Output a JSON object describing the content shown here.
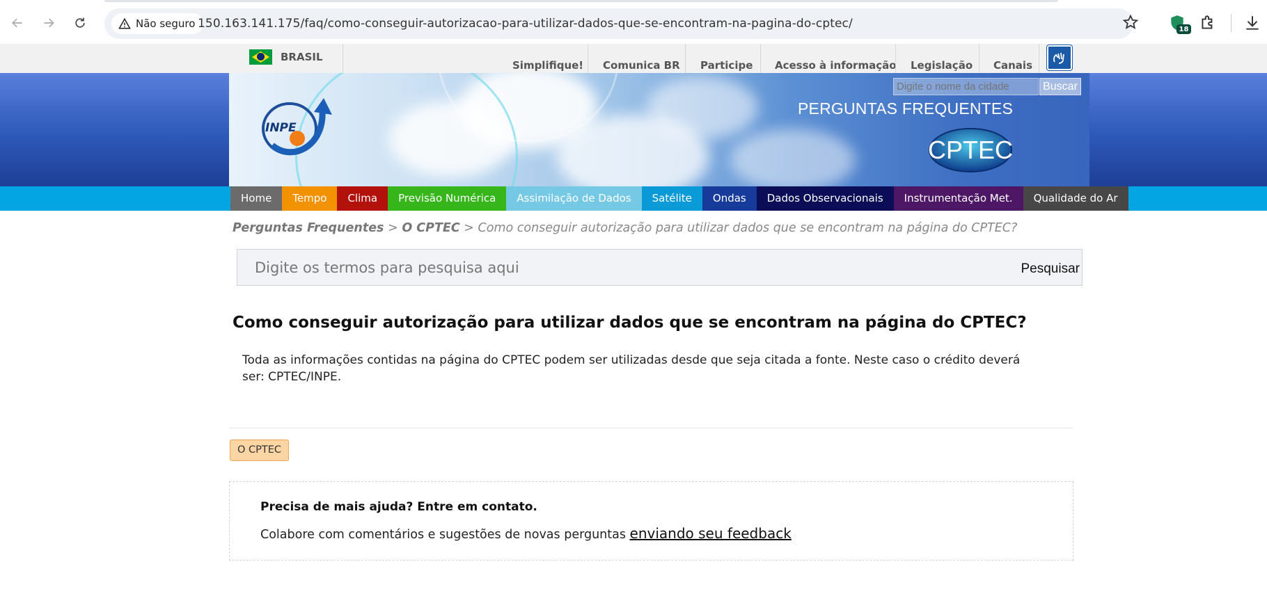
{
  "browser": {
    "security_label": "Não seguro",
    "url": "150.163.141.175/faq/como-conseguir-autorizacao-para-utilizar-dados-que-se-encontram-na-pagina-do-cptec/",
    "extension_badge": "18"
  },
  "govbar": {
    "country": "BRASIL",
    "links": [
      "Simplifique!",
      "Comunica BR",
      "Participe",
      "Acesso à informação",
      "Legislação",
      "Canais"
    ]
  },
  "header": {
    "logo_text": "INPE",
    "title": "PERGUNTAS FREQUENTES",
    "brand": "CPTEC",
    "city_search_placeholder": "Digite o nome da cidade",
    "city_search_button": "Buscar"
  },
  "menu": [
    {
      "label": "Home",
      "color": "#6b6b6b"
    },
    {
      "label": "Tempo",
      "color": "#f39200"
    },
    {
      "label": "Clima",
      "color": "#b3110c"
    },
    {
      "label": "Previsão Numérica",
      "color": "#36b61a"
    },
    {
      "label": "Assimilação de Dados",
      "color": "#75c9e4"
    },
    {
      "label": "Satélite",
      "color": "#0a9ad7"
    },
    {
      "label": "Ondas",
      "color": "#173b9a"
    },
    {
      "label": "Dados Observacionais",
      "color": "#0b0d57"
    },
    {
      "label": "Instrumentação Met.",
      "color": "#4e1766"
    },
    {
      "label": "Qualidade do Ar",
      "color": "#474747"
    }
  ],
  "breadcrumb": {
    "root": "Perguntas Frequentes",
    "sep": ">",
    "category": "O CPTEC",
    "current": "Como conseguir autorização para utilizar dados que se encontram na página do CPTEC?"
  },
  "search": {
    "placeholder": "Digite os termos para pesquisa aqui",
    "button": "Pesquisar"
  },
  "article": {
    "question": "Como conseguir autorização para utilizar dados que se encontram na página do CPTEC?",
    "answer": "Toda as informações contidas na página do CPTEC podem ser utilizadas desde que seja citada a fonte. Neste caso o crédito deverá ser: CPTEC/INPE.",
    "tag": "O CPTEC"
  },
  "help": {
    "heading": "Precisa de mais ajuda? Entre em contato.",
    "text": "Colabore com comentários e sugestões de novas perguntas",
    "link": "enviando seu feedback"
  }
}
